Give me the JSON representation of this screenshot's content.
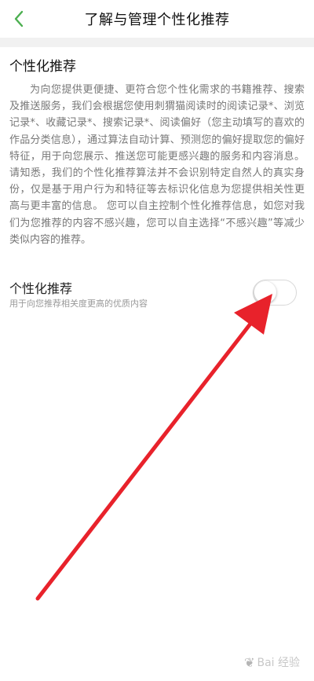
{
  "header": {
    "title": "了解与管理个性化推荐",
    "back_icon": "chevron-left-icon",
    "accent_color": "#4caf50"
  },
  "section": {
    "title": "个性化推荐",
    "description": "为向您提供更便捷、更符合您个性化需求的书籍推荐、搜索及推送服务，我们会根据您使用刺猬猫阅读时的阅读记录*、浏览记录*、收藏记录*、搜索记录*、阅读偏好（您主动填写的喜欢的作品分类信息），通过算法自动计算、预测您的偏好提取您的偏好特征，用于向您展示、推送您可能更感兴趣的服务和内容消息。请知悉，我们的个性化推荐算法并不会识别特定自然人的真实身份，仅是基于用户行为和特征等去标识化信息为您提供相关性更高与更丰富的信息。 您可以自主控制个性化推荐信息，如您对我们为您推荐的内容不感兴趣，您可以自主选择“不感兴趣”等减少类似内容的推荐。"
  },
  "toggle": {
    "title": "个性化推荐",
    "subtitle": "用于向您推荐相关度更高的优质内容",
    "state": "off"
  },
  "annotation": {
    "arrow_color": "#e8222b"
  },
  "watermark": {
    "text": "Bai 经验"
  }
}
